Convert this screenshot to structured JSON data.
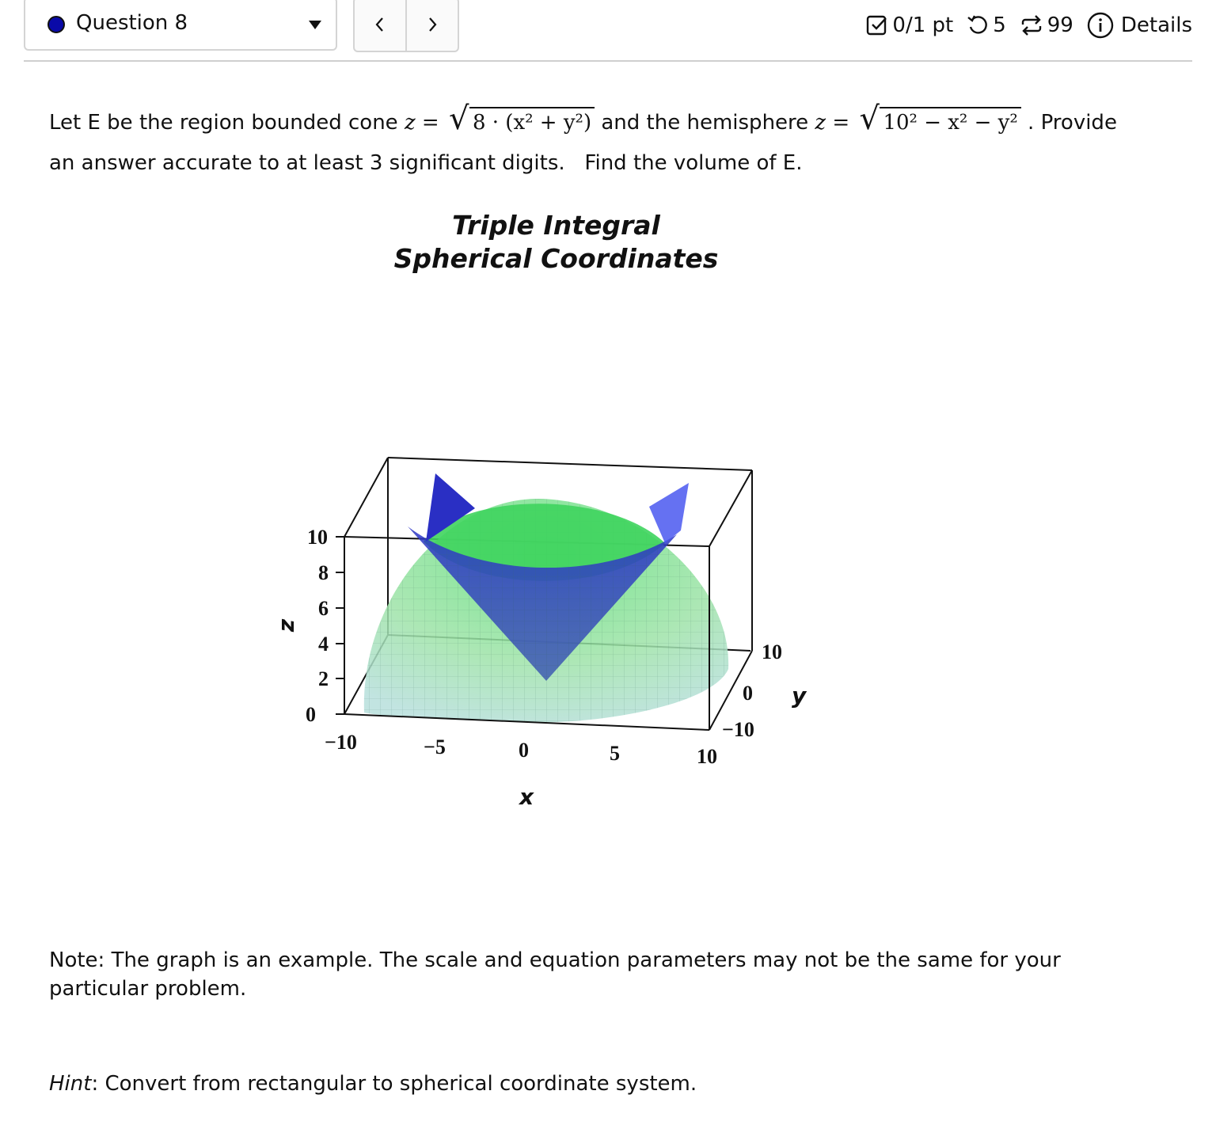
{
  "header": {
    "question_label": "Question 8",
    "status_color": "#0a0aa8",
    "prev_label": "<",
    "next_label": ">",
    "score": "0/1 pt",
    "score_icon": "checkbox-icon",
    "retries": "5",
    "retries_icon": "undo-icon",
    "attempts": "99",
    "attempts_icon": "repeat-icon",
    "details_label": "Details",
    "details_icon": "info-icon"
  },
  "problem": {
    "text1": "Let E be the region bounded cone",
    "cone_lhs": "z =",
    "cone_rhs": "8 · (x² + y²)",
    "text2": "and the hemisphere",
    "hemi_lhs": "z =",
    "hemi_rhs": "10² − x² − y²",
    "text3": ". Provide",
    "line2": "an answer accurate to at least 3 significant digits.   Find the volume of E."
  },
  "figure": {
    "title_line1": "Triple Integral",
    "title_line2": "Spherical Coordinates",
    "z_axis_label": "z",
    "x_axis_label": "x",
    "y_axis_label": "y",
    "z_ticks": [
      "0",
      "2",
      "4",
      "6",
      "8",
      "10"
    ],
    "x_ticks": [
      "−10",
      "−5",
      "0",
      "5",
      "10"
    ],
    "y_ticks": [
      "−10",
      "0",
      "10"
    ],
    "cone_color": "#2a3fd0",
    "hemisphere_color": "#4cd46a"
  },
  "note": "Note:  The graph is an example.  The scale and equation parameters may not be the same for your particular problem.",
  "hint": {
    "label": "Hint",
    "text": ": Convert from rectangular to spherical coordinate system."
  }
}
